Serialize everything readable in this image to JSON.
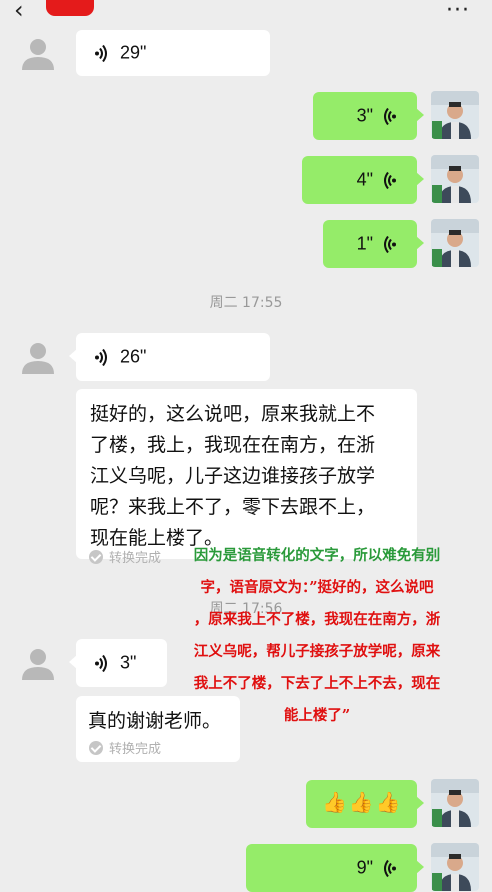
{
  "header": {
    "back_icon": "chevron-left-icon",
    "more_icon": "more-icon",
    "more_text": "···",
    "back_text": "‹"
  },
  "messages": {
    "m1": {
      "duration": "29\""
    },
    "m2": {
      "duration": "3\""
    },
    "m3": {
      "duration": "4\""
    },
    "m4": {
      "duration": "1\""
    },
    "ts1": "周二 17:55",
    "m5": {
      "duration": "26\""
    },
    "m6": {
      "lines": [
        "挺好的，这么说吧，原来我就上不",
        "了楼，我上，我现在在南方，在浙",
        "江义乌呢，儿子这边谁接孩子放学",
        "呢？来我上不了，零下去跟不上，",
        "现在能上楼了。"
      ],
      "status": "转换完成"
    },
    "ts2": "周二 17:56",
    "m7": {
      "duration": "3\""
    },
    "m8": {
      "text": "真的谢谢老师。",
      "status": "转换完成"
    },
    "m9": {
      "text": "👍👍👍"
    },
    "m10": {
      "duration": "9\""
    }
  },
  "annotation": {
    "green_part": "因为是语音转化的文字，所以难免有别",
    "lines": [
      "字，语音原文为：”挺好的，这么说吧",
      "，原来我上不了楼，我现在在南方，浙",
      "江义乌呢，帮儿子接孩子放学呢，原来",
      "我上不了楼，下去了上不上不去，现在",
      "能上楼了”"
    ]
  },
  "colors": {
    "bubble_green": "#95ec69",
    "background": "#ededed",
    "annotation_red": "#e01010",
    "annotation_green": "#2a9a3a"
  }
}
